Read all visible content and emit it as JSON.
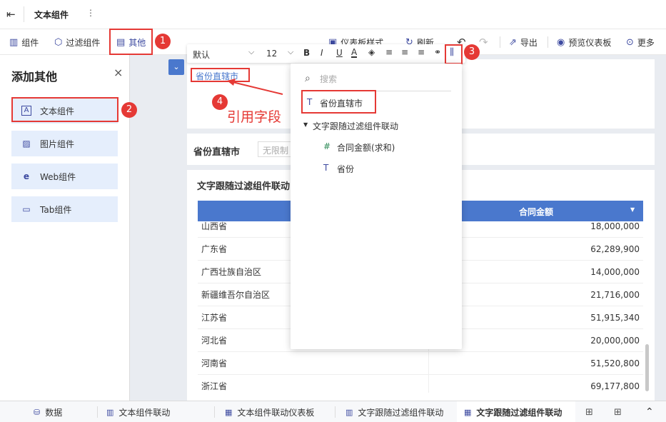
{
  "titlebar": {
    "back_icon": "back-arrow-icon",
    "title": "文本组件",
    "more": "⋮"
  },
  "toolbar": {
    "component": "组件",
    "filter_component": "过滤组件",
    "other": "其他",
    "dashboard_style": "仪表板样式",
    "refresh": "刷新",
    "export": "导出",
    "preview": "预览仪表板",
    "more": "更多"
  },
  "badges": {
    "b1": "1",
    "b2": "2",
    "b3": "3",
    "b4": "4"
  },
  "panel": {
    "title": "添加其他",
    "close": "×",
    "items": [
      {
        "label": "文本组件",
        "icon": "A"
      },
      {
        "label": "图片组件",
        "icon": "▨"
      },
      {
        "label": "Web组件",
        "icon": "e"
      },
      {
        "label": "Tab组件",
        "icon": "▭"
      }
    ]
  },
  "fmtbar": {
    "font": "默认",
    "size": "12"
  },
  "text_widget": {
    "field_chip": "省份直辖市"
  },
  "annotation": {
    "label": "引用字段"
  },
  "filter": {
    "label": "省份直辖市",
    "placeholder": "无限制"
  },
  "chart": {
    "title": "文字跟随过滤组件联动",
    "col2": "合同金额",
    "rows": [
      [
        "山西省",
        "18,000,000"
      ],
      [
        "广东省",
        "62,289,900"
      ],
      [
        "广西壮族自治区",
        "14,000,000"
      ],
      [
        "新疆维吾尔自治区",
        "21,716,000"
      ],
      [
        "江苏省",
        "51,915,340"
      ],
      [
        "河北省",
        "20,000,000"
      ],
      [
        "河南省",
        "51,520,800"
      ],
      [
        "浙江省",
        "69,177,800"
      ]
    ]
  },
  "dropdown": {
    "search_placeholder": "搜索",
    "selected_field": "省份直辖市",
    "group": "文字跟随过滤组件联动",
    "fields": [
      {
        "label": "合同金额(求和)",
        "icon": "#"
      },
      {
        "label": "省份",
        "icon": "T"
      }
    ]
  },
  "tabs": {
    "data": "数据",
    "t1": "文本组件联动",
    "t2": "文本组件联动仪表板",
    "t3": "文字跟随过滤组件联动",
    "t4": "文字跟随过滤组件联动"
  },
  "colors": {
    "accent": "#3d4aa0",
    "header_blue": "#4a78cd",
    "panel_btn": "#e5eefc",
    "annotation_red": "#e53935"
  }
}
